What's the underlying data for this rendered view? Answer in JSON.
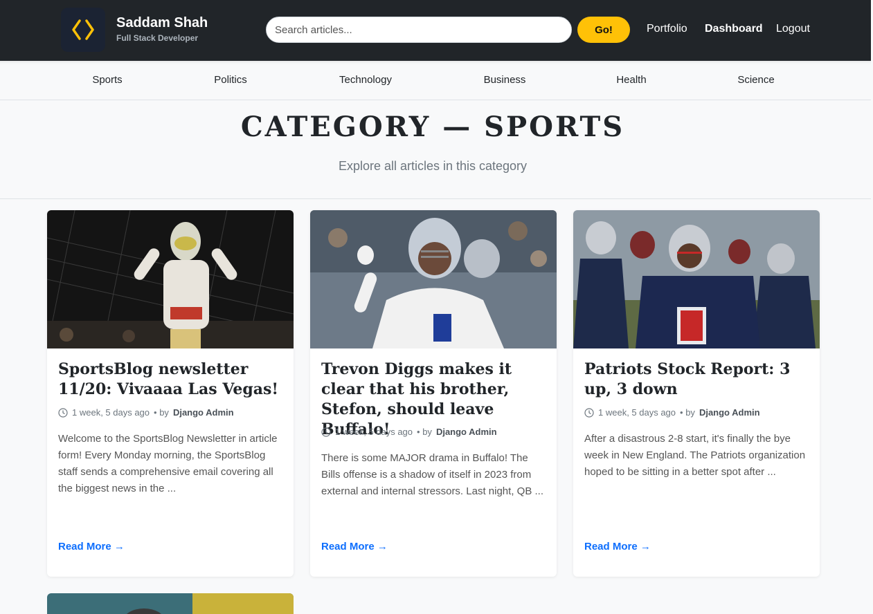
{
  "brand": {
    "name": "Saddam Shah",
    "subtitle": "Full Stack Developer",
    "accent": "#ffc107"
  },
  "search": {
    "placeholder": "Search articles...",
    "value": "",
    "button_label": "Go!"
  },
  "nav": {
    "portfolio": "Portfolio",
    "dashboard": "Dashboard",
    "logout": "Logout"
  },
  "categories": [
    "Sports",
    "Politics",
    "Technology",
    "Business",
    "Health",
    "Science"
  ],
  "header": {
    "title": "CATEGORY — SPORTS",
    "subtitle": "Explore all articles in this category"
  },
  "articles": [
    {
      "title": "SportsBlog newsletter 11/20: Vivaaaa Las Vegas!",
      "time": "1 week, 5 days ago",
      "by": "• by",
      "author": "Django Admin",
      "excerpt": "Welcome to the SportsBlog Newsletter in article form! Every Monday morning, the SportsBlog staff sends a comprehensive email covering all the biggest news in the ...",
      "read_more": "Read More →"
    },
    {
      "title": "Trevon Diggs makes it clear that his brother, Stefon, should leave Buffalo!",
      "time": "1 week, 5 days ago",
      "by": "• by",
      "author": "Django Admin",
      "excerpt": "There is some MAJOR drama in Buffalo! The Bills offense is a shadow of itself in 2023 from external and internal stressors. Last night, QB ...",
      "read_more": "Read More →"
    },
    {
      "title": "Patriots Stock Report: 3 up, 3 down",
      "time": "1 week, 5 days ago",
      "by": "• by",
      "author": "Django Admin",
      "excerpt": "After a disastrous 2-8 start, it's finally the bye week in New England. The Patriots organization hoped to be sitting in a better spot after ...",
      "read_more": "Read More →"
    }
  ],
  "colors": {
    "topbar": "#212529",
    "link": "#0d6efd",
    "background": "#f8f9fa"
  }
}
